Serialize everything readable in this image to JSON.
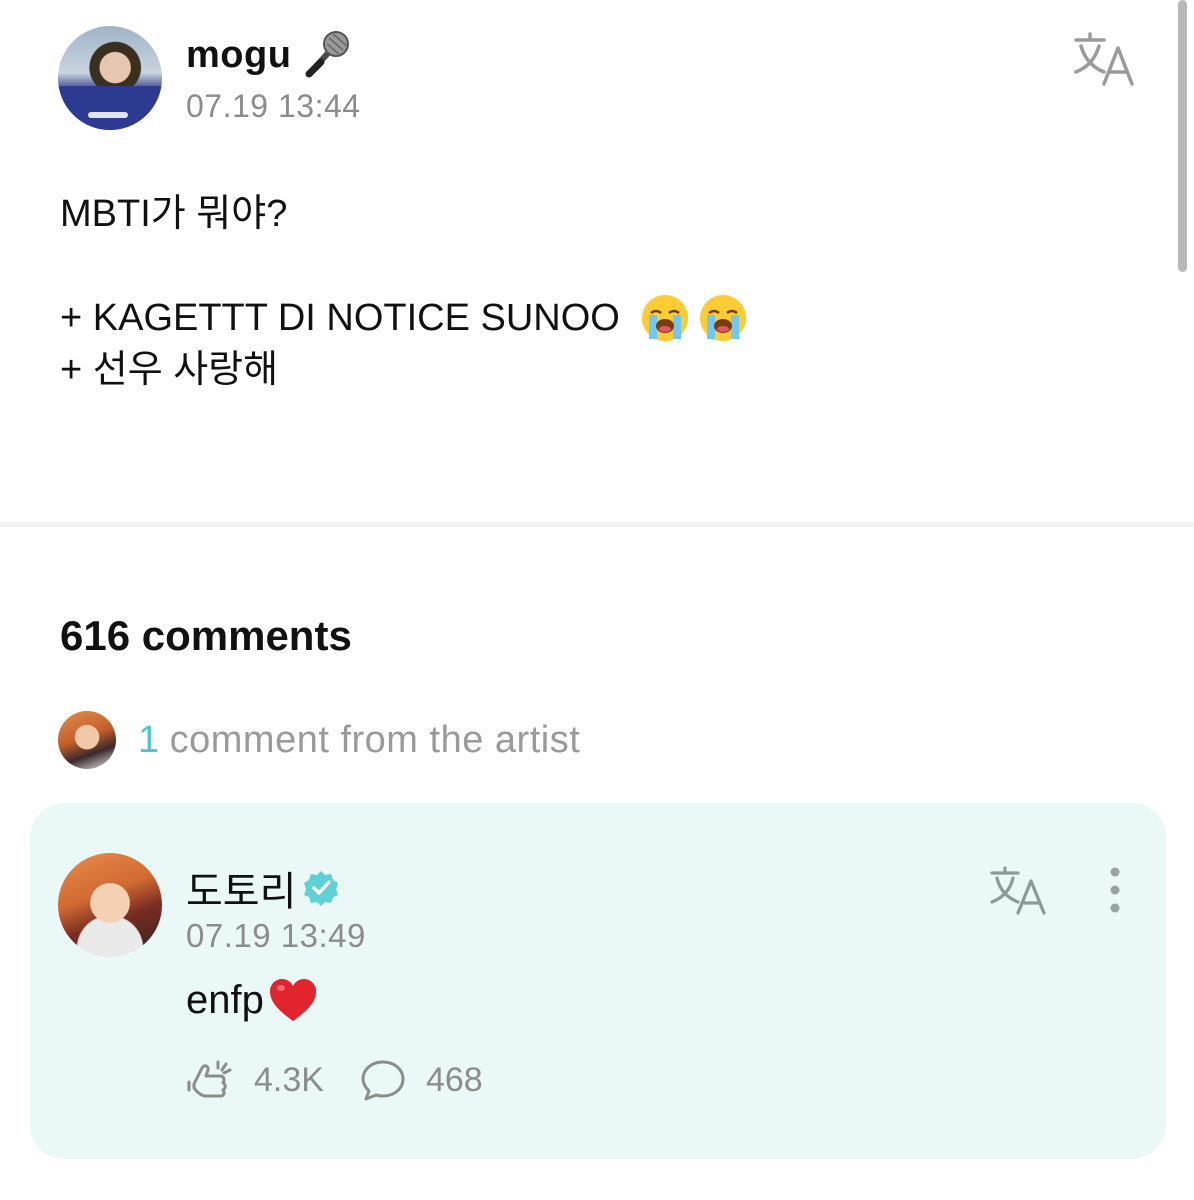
{
  "post": {
    "author": "mogu",
    "author_emoji": "microphone-icon",
    "timestamp": "07.19 13:44",
    "lines": [
      "MBTI가 뭐야?",
      "",
      "+ KAGETTT DI NOTICE SUNOO",
      "+ 선우 사랑해"
    ],
    "line3_emojis": [
      "loudly-crying-face-icon",
      "loudly-crying-face-icon"
    ]
  },
  "comments": {
    "count_label": "616 comments",
    "artist_count": "1",
    "artist_label": "comment from the artist"
  },
  "artist_comment": {
    "author": "도토리",
    "timestamp": "07.19 13:49",
    "text": "enfp",
    "cheers": "4.3K",
    "replies": "468"
  },
  "colors": {
    "accent": "#4cc7c9",
    "card_bg": "#eaf8f7",
    "muted_text": "#8c8c8c",
    "verified": "#5fd0d4"
  }
}
